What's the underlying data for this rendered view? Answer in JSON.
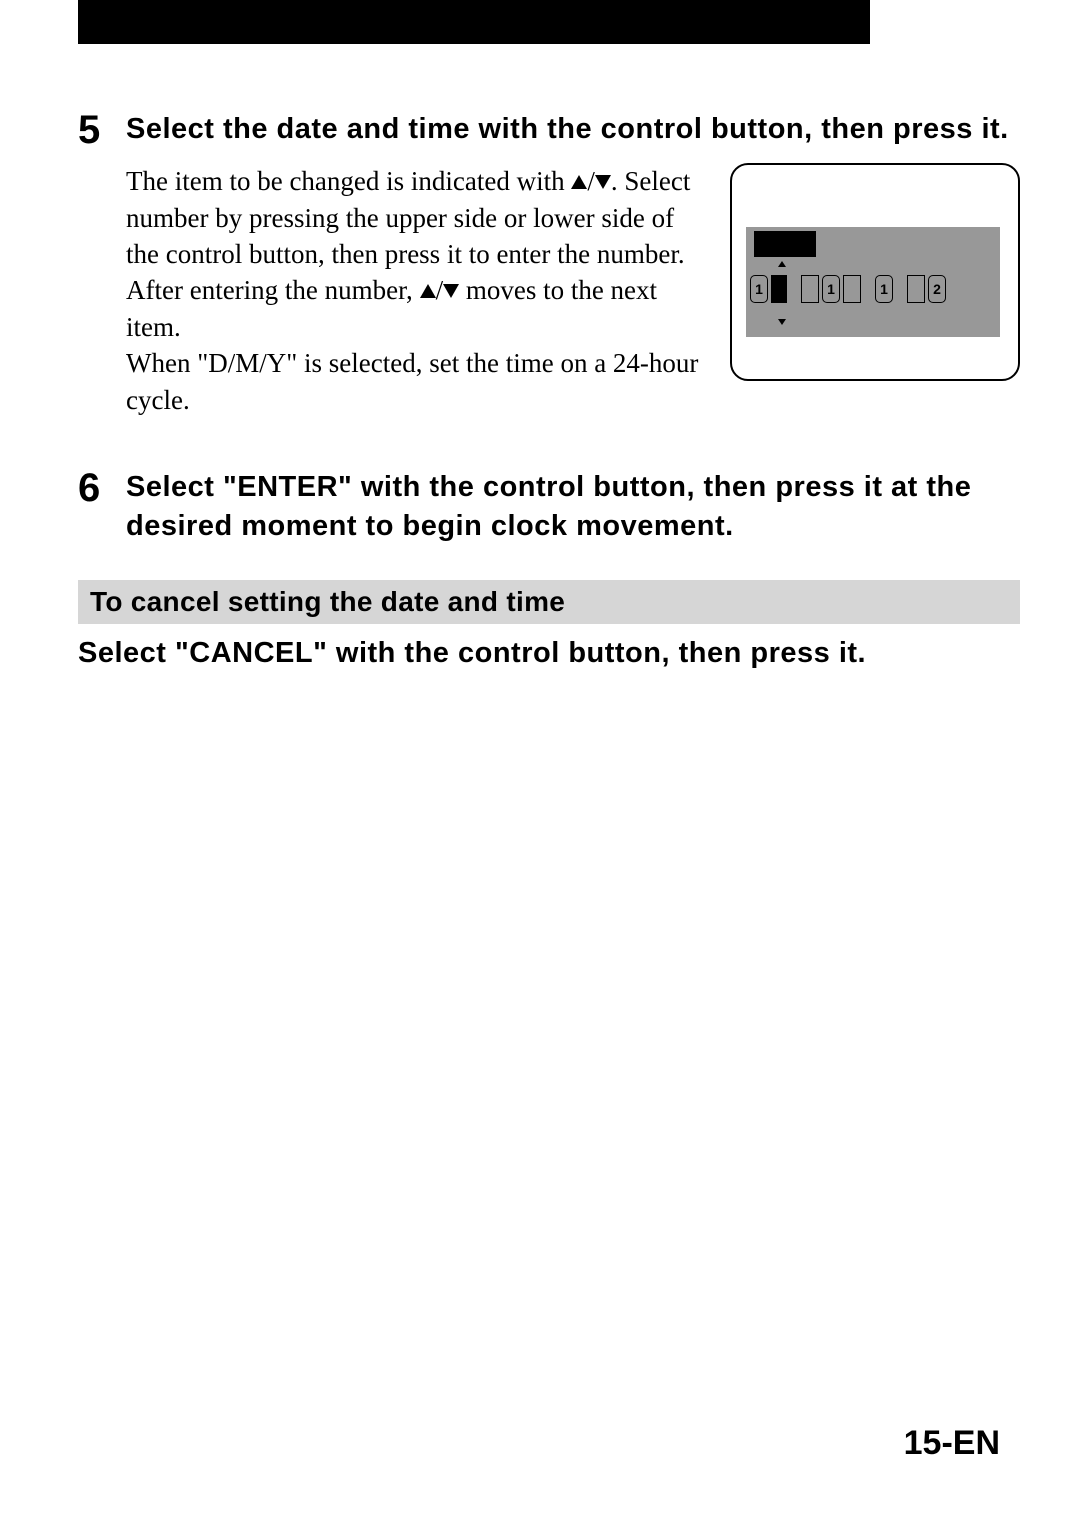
{
  "step5": {
    "num": "5",
    "heading": "Select the date and time with the control button, then press it.",
    "para1a": "The item to be changed is indicated with ",
    "para1b": ". Select number by pressing the upper side or lower side of the control button, then press it to enter the number.",
    "para2a": "After entering the number, ",
    "para2b": " moves to the next item.",
    "para3": "When \"D/M/Y\" is selected, set the time on a 24-hour cycle."
  },
  "figure": {
    "d1": "1",
    "d2": "1",
    "d3": "1",
    "d4": "2"
  },
  "step6": {
    "num": "6",
    "heading": "Select \"ENTER\" with the control button, then press it at the desired moment to begin clock movement."
  },
  "cancel": {
    "bar": "To cancel setting the date and time",
    "text": "Select \"CANCEL\" with the control button, then press it."
  },
  "page": "15-EN"
}
